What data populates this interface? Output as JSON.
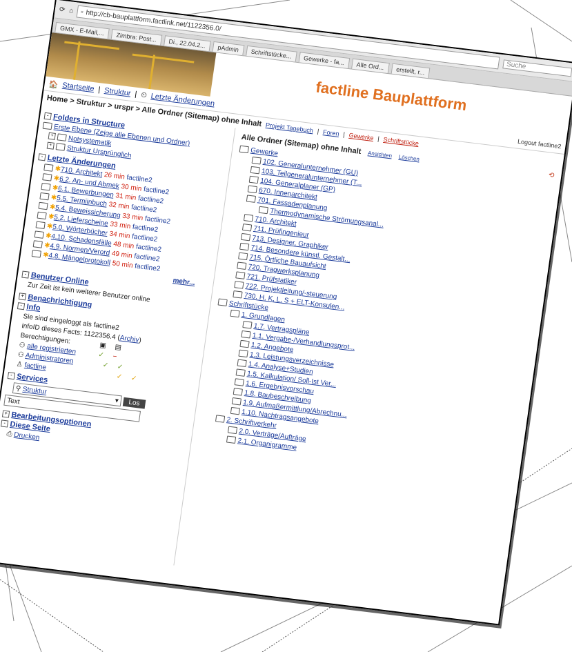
{
  "browser": {
    "url": "http://cb-bauplattform.factlink.net/1122356.0/",
    "search_placeholder": "Suche",
    "tabs": [
      "GMX - E-Mail,...",
      "Zimbra: Post...",
      "Di., 22.04.2...",
      "pAdmin",
      "Schriftstücke...",
      "Gewerke - fa...",
      "Alle Ord...",
      "erstellt, r..."
    ]
  },
  "header": {
    "brand": "factline Bauplattform",
    "nav": [
      "Startseite",
      "Struktur",
      "Letzte Änderungen"
    ],
    "subnav": [
      "Projekt Tagebuch",
      "Foren",
      "Gewerke",
      "Schriftstücke"
    ],
    "logout": "Logout factline2",
    "breadcrumb": "Home > Struktur > urspr > Alle Ordner (Sitemap) ohne Inhalt"
  },
  "left": {
    "folders_title": "Folders in Structure",
    "folders": [
      "Erste Ebene (Zeige alle Ebenen und Ordner)",
      "Notsystematik",
      "Struktur Ursprünglich"
    ],
    "changes_title": "Letzte Änderungen",
    "changes": [
      {
        "name": "710. Architekt",
        "time": "26 min",
        "user": "factline2"
      },
      {
        "name": "6.2. An- und Abmek",
        "time": "30 min",
        "user": "factline2"
      },
      {
        "name": "6.1. Bewerbungen",
        "time": "31 min",
        "user": "factline2"
      },
      {
        "name": "5.5. Termiinbuch",
        "time": "32 min",
        "user": "factline2"
      },
      {
        "name": "5.4. Beweissicherung",
        "time": "33 min",
        "user": "factline2"
      },
      {
        "name": "5.2. Lieferscheine",
        "time": "33 min",
        "user": "factline2"
      },
      {
        "name": "5.0. Wörterbücher",
        "time": "34 min",
        "user": "factline2"
      },
      {
        "name": "4.10. Schadensfälle",
        "time": "48 min",
        "user": "factline2"
      },
      {
        "name": "4.9. Normen/Verord",
        "time": "49 min",
        "user": "factline2"
      },
      {
        "name": "4.8. Mängelprotokoll",
        "time": "50 min",
        "user": "factline2"
      }
    ],
    "more": "mehr...",
    "online_title": "Benutzer Online",
    "online_text": "Zur Zeit ist kein weiterer Benutzer online",
    "notify_title": "Benachrichtigung",
    "info_title": "Info",
    "info_line1": "Sie sind eingeloggt als factline2",
    "info_line2": "infoID dieses Facts: 1122356.4 (",
    "info_archive": "Archiv",
    "info_line2_end": ")",
    "perms": "Berechtigungen:",
    "perm_rows": [
      "alle registrierten",
      "Administratoren"
    ],
    "user": "factline",
    "services_title": "Services",
    "services_select": "Struktur",
    "services_btn": "Los",
    "services_input": "Text",
    "edit_title": "Bearbeitungsoptionen",
    "page_title": "Diese Seite",
    "print": "Drucken"
  },
  "right": {
    "title": "Alle Ordner (Sitemap) ohne Inhalt",
    "actions": [
      "Ansichten",
      "Löschen"
    ],
    "tree": [
      {
        "label": "Gewerke",
        "level": 0
      },
      {
        "label": "102. Generalunternehmer (GU)",
        "level": 1
      },
      {
        "label": "103. Teilgeneralunternehmer (T...",
        "level": 1
      },
      {
        "label": "104. Generalplaner (GP)",
        "level": 1
      },
      {
        "label": "670. Innenarchitekt",
        "level": 1
      },
      {
        "label": "701. Fassadenplanung",
        "level": 1
      },
      {
        "label": "Thermodynamische Strömungsanal...",
        "level": 2
      },
      {
        "label": "710. Architekt",
        "level": 1
      },
      {
        "label": "711. Prüfingenieur",
        "level": 1
      },
      {
        "label": "713. Designer, Graphiker",
        "level": 1
      },
      {
        "label": "714. Besondere künstl. Gestalt...",
        "level": 1
      },
      {
        "label": "715. Örtliche Bauaufsicht",
        "level": 1
      },
      {
        "label": "720. Tragwerksplanung",
        "level": 1
      },
      {
        "label": "721. Prüfstatiker",
        "level": 1
      },
      {
        "label": "722. Projektleitung/-steuerung",
        "level": 1
      },
      {
        "label": "730. H, K, L, S + ELT-Konsulen...",
        "level": 1
      },
      {
        "label": "Schriftstücke",
        "level": 0
      },
      {
        "label": "1. Grundlagen",
        "level": 1
      },
      {
        "label": "1.7. Vertragspläne",
        "level": 2
      },
      {
        "label": "1.1. Vergabe-/Verhandlungsprot...",
        "level": 2
      },
      {
        "label": "1.2. Angebote",
        "level": 2
      },
      {
        "label": "1.3. Leistungsverzeichnisse",
        "level": 2
      },
      {
        "label": "1.4. Analyse+Studien",
        "level": 2
      },
      {
        "label": "1.5. Kalkulation/ Soll-Ist Ver...",
        "level": 2
      },
      {
        "label": "1.6. Ergebnisvorschau",
        "level": 2
      },
      {
        "label": "1.8. Baubeschreibung",
        "level": 2
      },
      {
        "label": "1.9. Aufmaßermittlung/Abrechnu...",
        "level": 2
      },
      {
        "label": "1.10. Nachtragsangebote",
        "level": 2
      },
      {
        "label": "2. Schriftverkehr",
        "level": 1
      },
      {
        "label": "2.0. Verträge/Aufträge",
        "level": 2
      },
      {
        "label": "2.1. Organigramme",
        "level": 2
      }
    ]
  }
}
